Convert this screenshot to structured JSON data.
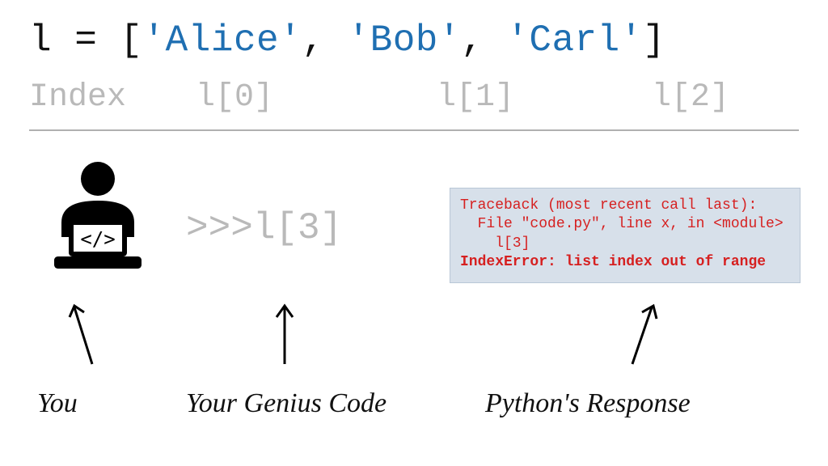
{
  "code": {
    "pre": "l = [",
    "items": [
      "'Alice'",
      "'Bob'",
      "'Carl'"
    ],
    "sep": ", ",
    "post": "]"
  },
  "index": {
    "label": "Index",
    "cells": [
      "l[0]",
      "l[1]",
      "l[2]"
    ]
  },
  "prompt": ">>>l[3]",
  "traceback": {
    "line1": "Traceback (most recent call last):",
    "line2": "  File \"code.py\", line x, in <module>",
    "line3": "    l[3]",
    "error": "IndexError: list index out of range"
  },
  "captions": {
    "you": "You",
    "code": "Your Genius Code",
    "response": "Python's Response"
  },
  "colors": {
    "string": "#1f6fb2",
    "muted": "#b9b9b9",
    "error": "#d62020",
    "errbg": "#d7e0ea"
  }
}
